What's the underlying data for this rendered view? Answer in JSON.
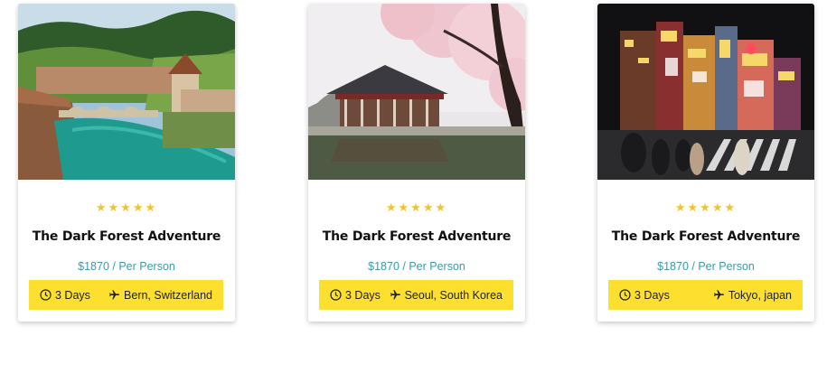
{
  "tours": [
    {
      "photo_icon": "bern-river-photo",
      "rating": "★★★★★",
      "title": "The Dark Forest Adventure",
      "price": "$1870 / Per Person",
      "duration": "3 Days",
      "destination": "Bern, Switzerland"
    },
    {
      "photo_icon": "korean-pavilion-photo",
      "rating": "★★★★★",
      "title": "The Dark Forest Adventure",
      "price": "$1870 / Per Person",
      "duration": "3 Days",
      "destination": "Seoul, South Korea"
    },
    {
      "photo_icon": "tokyo-street-photo",
      "rating": "★★★★★",
      "title": "The Dark Forest Adventure",
      "price": "$1870 / Per Person",
      "duration": "3 Days",
      "destination": "Tokyo, japan"
    }
  ],
  "colors": {
    "star": "#f2c230",
    "price": "#3a9ba8",
    "info_bar": "#fde02f"
  },
  "icons": {
    "duration": "clock-icon",
    "destination": "airplane-icon"
  }
}
